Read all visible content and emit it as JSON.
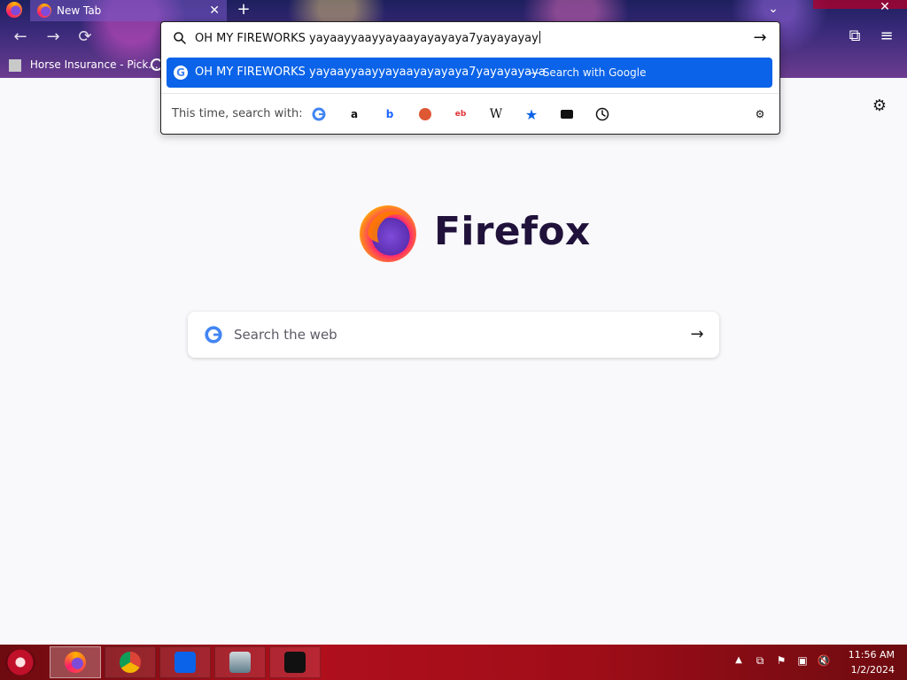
{
  "browser": {
    "tab_title": "New Tab",
    "bookmark_label": "Horse Insurance - Pick..."
  },
  "urlbar": {
    "typed_text": "OH MY FIREWORKS yayaayyaayyayaayayayaya7yayayayay",
    "suggestion_text": "OH MY FIREWORKS yayaayyaayyayaayayayaya7yayayayaya",
    "suggestion_suffix": "— Search with Google",
    "oneoff_label": "This time, search with:"
  },
  "newtab": {
    "wordmark": "Firefox",
    "search_placeholder": "Search the web"
  },
  "taskbar": {
    "time": "11:56 AM",
    "date": "1/2/2024"
  },
  "colors": {
    "highlight_blue": "#0a63e8",
    "taskbar_red": "#b00f1c"
  }
}
